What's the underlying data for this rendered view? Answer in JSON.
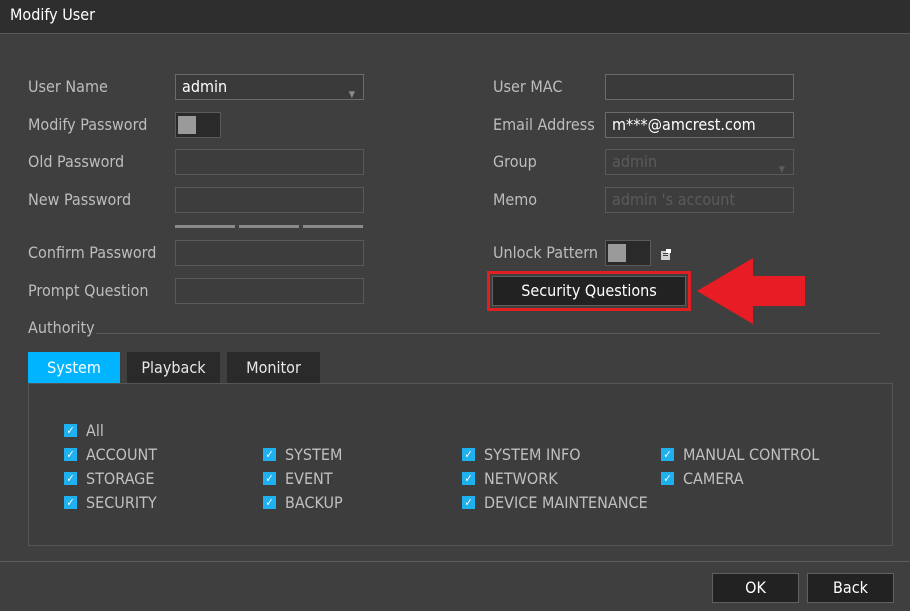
{
  "window": {
    "title": "Modify User"
  },
  "form": {
    "username": {
      "label": "User Name",
      "value": "admin"
    },
    "modify_password": {
      "label": "Modify Password"
    },
    "old_password": {
      "label": "Old Password",
      "value": ""
    },
    "new_password": {
      "label": "New Password",
      "value": ""
    },
    "confirm_password": {
      "label": "Confirm Password",
      "value": ""
    },
    "prompt_question": {
      "label": "Prompt Question",
      "value": ""
    },
    "user_mac": {
      "label": "User MAC",
      "value": ""
    },
    "email": {
      "label": "Email Address",
      "value": "m***@amcrest.com"
    },
    "group": {
      "label": "Group",
      "value": "admin"
    },
    "memo": {
      "label": "Memo",
      "value": "admin 's account"
    },
    "unlock_pattern": {
      "label": "Unlock Pattern"
    },
    "security_questions_label": "Security Questions"
  },
  "authority": {
    "label": "Authority",
    "tabs": [
      {
        "label": "System",
        "active": true
      },
      {
        "label": "Playback",
        "active": false
      },
      {
        "label": "Monitor",
        "active": false
      }
    ],
    "permissions": {
      "all": "All",
      "columns": [
        [
          "ACCOUNT",
          "STORAGE",
          "SECURITY"
        ],
        [
          "SYSTEM",
          "EVENT",
          "BACKUP"
        ],
        [
          "SYSTEM INFO",
          "NETWORK",
          "DEVICE MAINTENANCE"
        ],
        [
          "MANUAL CONTROL",
          "CAMERA"
        ]
      ]
    }
  },
  "footer": {
    "ok_label": "OK",
    "back_label": "Back"
  },
  "colors": {
    "accent": "#00b4ff",
    "highlight": "#e02020",
    "checkbox": "#1fb0f0"
  }
}
